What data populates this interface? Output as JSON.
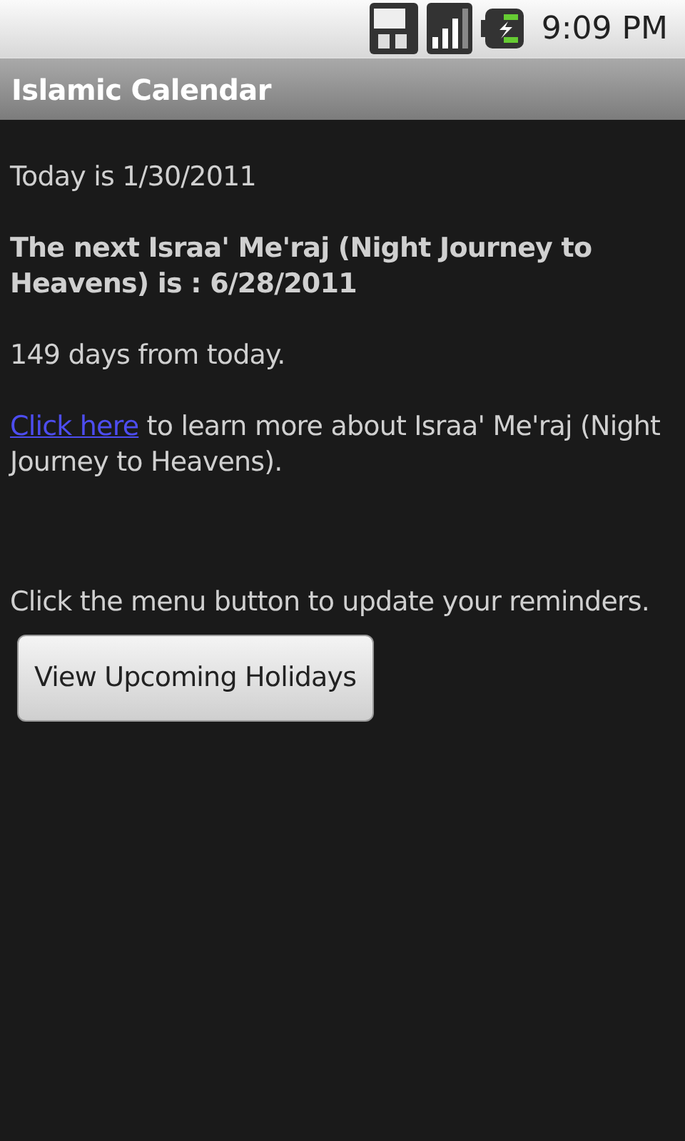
{
  "status_bar": {
    "time": "9:09 PM"
  },
  "window": {
    "title": "Islamic Calendar"
  },
  "today": "Today is 1/30/2011",
  "next_event": "The next Israa' Me'raj (Night Journey to Heavens) is : 6/28/2011",
  "countdown": "149 days from today.",
  "more_info": {
    "link": "Click here",
    "text": " to learn more about Israa' Me'raj (Night Journey to Heavens)."
  },
  "hint": "Click the menu button to update your reminders.",
  "buttons": [
    "View Upcoming Holidays"
  ]
}
